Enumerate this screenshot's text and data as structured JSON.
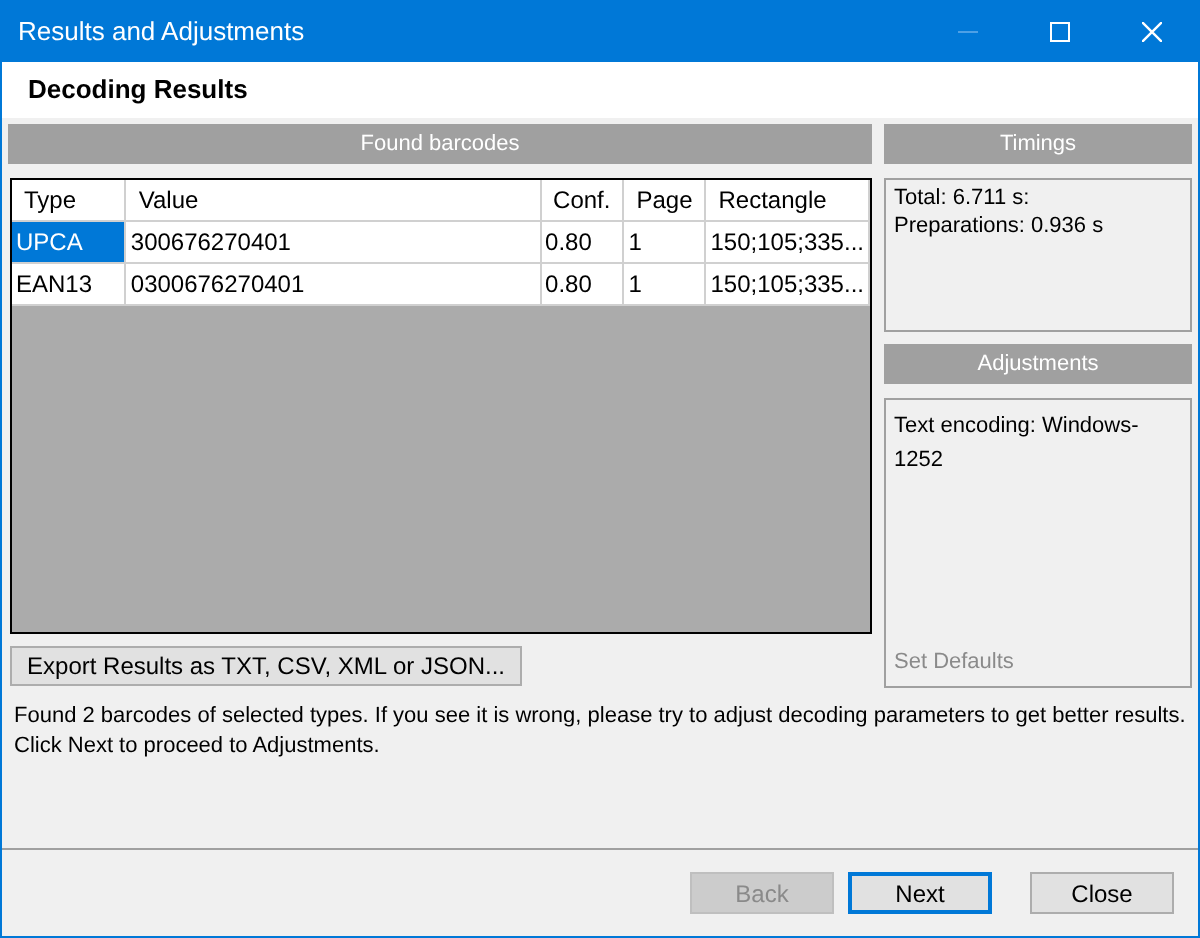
{
  "window": {
    "title": "Results and Adjustments",
    "controls": [
      {
        "kind": "minimize",
        "disabled": true
      },
      {
        "kind": "maximize",
        "disabled": false
      },
      {
        "kind": "close",
        "disabled": false
      }
    ]
  },
  "heading": "Decoding Results",
  "found_panel": {
    "title": "Found barcodes",
    "columns": [
      "Type",
      "Value",
      "Conf.",
      "Page",
      "Rectangle"
    ],
    "rows": [
      {
        "cells": [
          "UPCA",
          "300676270401",
          "0.80",
          "1",
          "150;105;335..."
        ],
        "selected": true
      },
      {
        "cells": [
          "EAN13",
          "0300676270401",
          "0.80",
          "1",
          "150;105;335..."
        ],
        "selected": false
      }
    ]
  },
  "export_button": "Export Results as TXT, CSV, XML or JSON...",
  "message": [
    "Found 2 barcodes of selected types. If you see it is wrong, please try to adjust decoding parameters to get better results.",
    "Click Next to proceed to Adjustments."
  ],
  "timings": {
    "title": "Timings",
    "lines": [
      "Total: 6.711 s:",
      "Preparations: 0.936 s"
    ]
  },
  "adjustments": {
    "title": "Adjustments",
    "lines": [
      "Text encoding: Windows-1252"
    ],
    "set_defaults": {
      "label": "Set Defaults",
      "disabled": true
    }
  },
  "buttons": [
    {
      "label": "Back",
      "disabled": true,
      "default": false
    },
    {
      "label": "Next",
      "disabled": false,
      "default": true
    },
    {
      "label": "Close",
      "disabled": false,
      "default": false
    }
  ]
}
